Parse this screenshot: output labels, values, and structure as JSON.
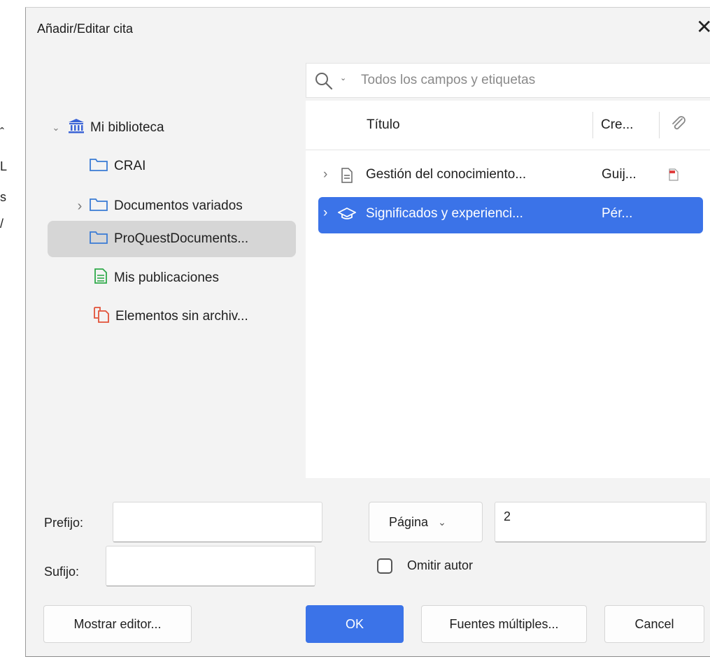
{
  "dialog": {
    "title": "Añadir/Editar cita",
    "close_glyph": "✕"
  },
  "search": {
    "placeholder": "Todos los campos y etiquetas",
    "icon": "search-icon",
    "dropdown_glyph": "⌄"
  },
  "library": {
    "items": [
      {
        "label": "Mi biblioteca",
        "icon": "library-icon",
        "twisty": "⌄"
      },
      {
        "label": "CRAI",
        "icon": "folder-icon",
        "twisty": ""
      },
      {
        "label": "Documentos variados",
        "icon": "folder-icon",
        "twisty": "›"
      },
      {
        "label": "ProQuestDocuments...",
        "icon": "folder-icon",
        "twisty": "",
        "selected": true
      },
      {
        "label": "Mis publicaciones",
        "icon": "publications-icon",
        "twisty": ""
      },
      {
        "label": "Elementos sin archiv...",
        "icon": "unfiled-icon",
        "twisty": ""
      }
    ]
  },
  "items_table": {
    "columns": [
      "Título",
      "Cre..."
    ],
    "attachment_column_icon": "paperclip-icon",
    "rows": [
      {
        "twisty": "›",
        "icon": "document-icon",
        "title": "Gestión del conocimiento...",
        "creator": "Guij...",
        "attachment": "pdf-icon",
        "selected": false
      },
      {
        "twisty": "›",
        "icon": "thesis-icon",
        "title": "Significados y experienci...",
        "creator": "Pér...",
        "attachment": "",
        "selected": true
      }
    ]
  },
  "citation": {
    "prefix_label": "Prefijo:",
    "prefix_value": "",
    "suffix_label": "Sufijo:",
    "suffix_value": "",
    "locator_label": "Página",
    "locator_chevron": "⌄",
    "locator_value": "2",
    "omit_author_label": "Omitir autor",
    "omit_author_checked": false
  },
  "buttons": {
    "show_editor": "Mostrar editor...",
    "ok": "OK",
    "multiple_sources": "Fuentes múltiples...",
    "cancel": "Cancel"
  },
  "colors": {
    "accent": "#3b73e8",
    "library_icon": "#3a63d6",
    "folder_icon": "#3a7bd5",
    "publications_icon": "#2faa4a",
    "unfiled_icon": "#e2533a"
  }
}
